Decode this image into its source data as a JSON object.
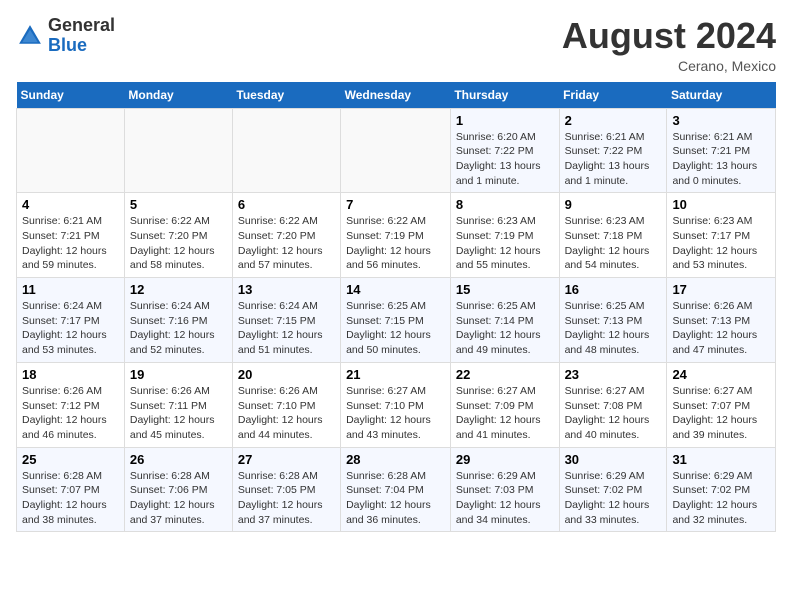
{
  "logo": {
    "general": "General",
    "blue": "Blue"
  },
  "header": {
    "month_year": "August 2024",
    "location": "Cerano, Mexico"
  },
  "days_of_week": [
    "Sunday",
    "Monday",
    "Tuesday",
    "Wednesday",
    "Thursday",
    "Friday",
    "Saturday"
  ],
  "weeks": [
    [
      {
        "day": "",
        "info": ""
      },
      {
        "day": "",
        "info": ""
      },
      {
        "day": "",
        "info": ""
      },
      {
        "day": "",
        "info": ""
      },
      {
        "day": "1",
        "info": "Sunrise: 6:20 AM\nSunset: 7:22 PM\nDaylight: 13 hours\nand 1 minute."
      },
      {
        "day": "2",
        "info": "Sunrise: 6:21 AM\nSunset: 7:22 PM\nDaylight: 13 hours\nand 1 minute."
      },
      {
        "day": "3",
        "info": "Sunrise: 6:21 AM\nSunset: 7:21 PM\nDaylight: 13 hours\nand 0 minutes."
      }
    ],
    [
      {
        "day": "4",
        "info": "Sunrise: 6:21 AM\nSunset: 7:21 PM\nDaylight: 12 hours\nand 59 minutes."
      },
      {
        "day": "5",
        "info": "Sunrise: 6:22 AM\nSunset: 7:20 PM\nDaylight: 12 hours\nand 58 minutes."
      },
      {
        "day": "6",
        "info": "Sunrise: 6:22 AM\nSunset: 7:20 PM\nDaylight: 12 hours\nand 57 minutes."
      },
      {
        "day": "7",
        "info": "Sunrise: 6:22 AM\nSunset: 7:19 PM\nDaylight: 12 hours\nand 56 minutes."
      },
      {
        "day": "8",
        "info": "Sunrise: 6:23 AM\nSunset: 7:19 PM\nDaylight: 12 hours\nand 55 minutes."
      },
      {
        "day": "9",
        "info": "Sunrise: 6:23 AM\nSunset: 7:18 PM\nDaylight: 12 hours\nand 54 minutes."
      },
      {
        "day": "10",
        "info": "Sunrise: 6:23 AM\nSunset: 7:17 PM\nDaylight: 12 hours\nand 53 minutes."
      }
    ],
    [
      {
        "day": "11",
        "info": "Sunrise: 6:24 AM\nSunset: 7:17 PM\nDaylight: 12 hours\nand 53 minutes."
      },
      {
        "day": "12",
        "info": "Sunrise: 6:24 AM\nSunset: 7:16 PM\nDaylight: 12 hours\nand 52 minutes."
      },
      {
        "day": "13",
        "info": "Sunrise: 6:24 AM\nSunset: 7:15 PM\nDaylight: 12 hours\nand 51 minutes."
      },
      {
        "day": "14",
        "info": "Sunrise: 6:25 AM\nSunset: 7:15 PM\nDaylight: 12 hours\nand 50 minutes."
      },
      {
        "day": "15",
        "info": "Sunrise: 6:25 AM\nSunset: 7:14 PM\nDaylight: 12 hours\nand 49 minutes."
      },
      {
        "day": "16",
        "info": "Sunrise: 6:25 AM\nSunset: 7:13 PM\nDaylight: 12 hours\nand 48 minutes."
      },
      {
        "day": "17",
        "info": "Sunrise: 6:26 AM\nSunset: 7:13 PM\nDaylight: 12 hours\nand 47 minutes."
      }
    ],
    [
      {
        "day": "18",
        "info": "Sunrise: 6:26 AM\nSunset: 7:12 PM\nDaylight: 12 hours\nand 46 minutes."
      },
      {
        "day": "19",
        "info": "Sunrise: 6:26 AM\nSunset: 7:11 PM\nDaylight: 12 hours\nand 45 minutes."
      },
      {
        "day": "20",
        "info": "Sunrise: 6:26 AM\nSunset: 7:10 PM\nDaylight: 12 hours\nand 44 minutes."
      },
      {
        "day": "21",
        "info": "Sunrise: 6:27 AM\nSunset: 7:10 PM\nDaylight: 12 hours\nand 43 minutes."
      },
      {
        "day": "22",
        "info": "Sunrise: 6:27 AM\nSunset: 7:09 PM\nDaylight: 12 hours\nand 41 minutes."
      },
      {
        "day": "23",
        "info": "Sunrise: 6:27 AM\nSunset: 7:08 PM\nDaylight: 12 hours\nand 40 minutes."
      },
      {
        "day": "24",
        "info": "Sunrise: 6:27 AM\nSunset: 7:07 PM\nDaylight: 12 hours\nand 39 minutes."
      }
    ],
    [
      {
        "day": "25",
        "info": "Sunrise: 6:28 AM\nSunset: 7:07 PM\nDaylight: 12 hours\nand 38 minutes."
      },
      {
        "day": "26",
        "info": "Sunrise: 6:28 AM\nSunset: 7:06 PM\nDaylight: 12 hours\nand 37 minutes."
      },
      {
        "day": "27",
        "info": "Sunrise: 6:28 AM\nSunset: 7:05 PM\nDaylight: 12 hours\nand 37 minutes."
      },
      {
        "day": "28",
        "info": "Sunrise: 6:28 AM\nSunset: 7:04 PM\nDaylight: 12 hours\nand 36 minutes."
      },
      {
        "day": "29",
        "info": "Sunrise: 6:29 AM\nSunset: 7:03 PM\nDaylight: 12 hours\nand 34 minutes."
      },
      {
        "day": "30",
        "info": "Sunrise: 6:29 AM\nSunset: 7:02 PM\nDaylight: 12 hours\nand 33 minutes."
      },
      {
        "day": "31",
        "info": "Sunrise: 6:29 AM\nSunset: 7:02 PM\nDaylight: 12 hours\nand 32 minutes."
      }
    ]
  ]
}
